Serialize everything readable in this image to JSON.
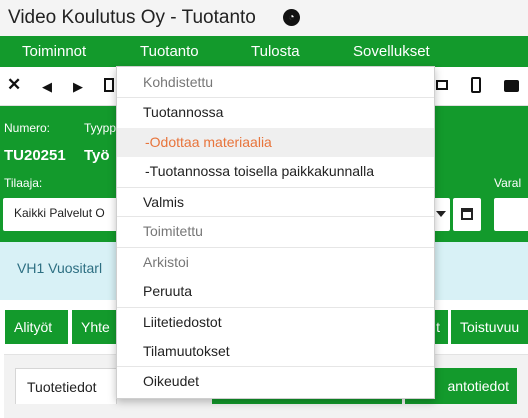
{
  "window": {
    "title": "Video Koulutus Oy - Tuotanto",
    "title_icon": "speedometer-icon"
  },
  "menubar": {
    "items": [
      "Toiminnot",
      "Tuotanto",
      "Tulosta",
      "Sovellukset"
    ]
  },
  "toolbar": {
    "icons": [
      "close-icon",
      "chevron-left-icon",
      "chevron-right-icon",
      "document-icon",
      "email-icon",
      "mobile-icon",
      "briefcase-icon"
    ]
  },
  "form": {
    "numero_label": "Numero:",
    "numero_value": "TU20251",
    "tyyppi_label": "Tyyppi",
    "tyyppi_value": "Työ",
    "tilaaja_label": "Tilaaja:",
    "tilaaja_value": "Kaikki Palvelut O",
    "varaus_label": "Varal"
  },
  "info": {
    "text": "VH1 Vuositarl"
  },
  "tabs": {
    "labels": [
      "Alityöt",
      "Yhte",
      "t",
      "Toistuvuu"
    ]
  },
  "subtabs": {
    "first": "Tuotetiedot",
    "last": "antotiedot"
  },
  "dropdown": {
    "items": [
      {
        "label": "Kohdistettu",
        "state": "muted"
      },
      {
        "label": "Tuotannossa",
        "state": "normal"
      },
      {
        "label": "-Odottaa materiaalia",
        "state": "highlight"
      },
      {
        "label": "-Tuotannossa toisella paikkakunnalla",
        "state": "normal"
      },
      {
        "label": "Valmis",
        "state": "normal"
      },
      {
        "label": "Toimitettu",
        "state": "muted"
      },
      {
        "label": "Arkistoi",
        "state": "muted"
      },
      {
        "label": "Peruuta",
        "state": "normal"
      },
      {
        "label": "Liitetiedostot",
        "state": "normal"
      },
      {
        "label": "Tilamuutokset",
        "state": "normal"
      },
      {
        "label": "Oikeudet",
        "state": "normal"
      }
    ]
  },
  "colors": {
    "brand_green": "#139a2c",
    "info_bg": "#d8f1f6",
    "highlight_text": "#e8743b",
    "highlight_bg": "#efefef",
    "muted_text": "#777777"
  }
}
